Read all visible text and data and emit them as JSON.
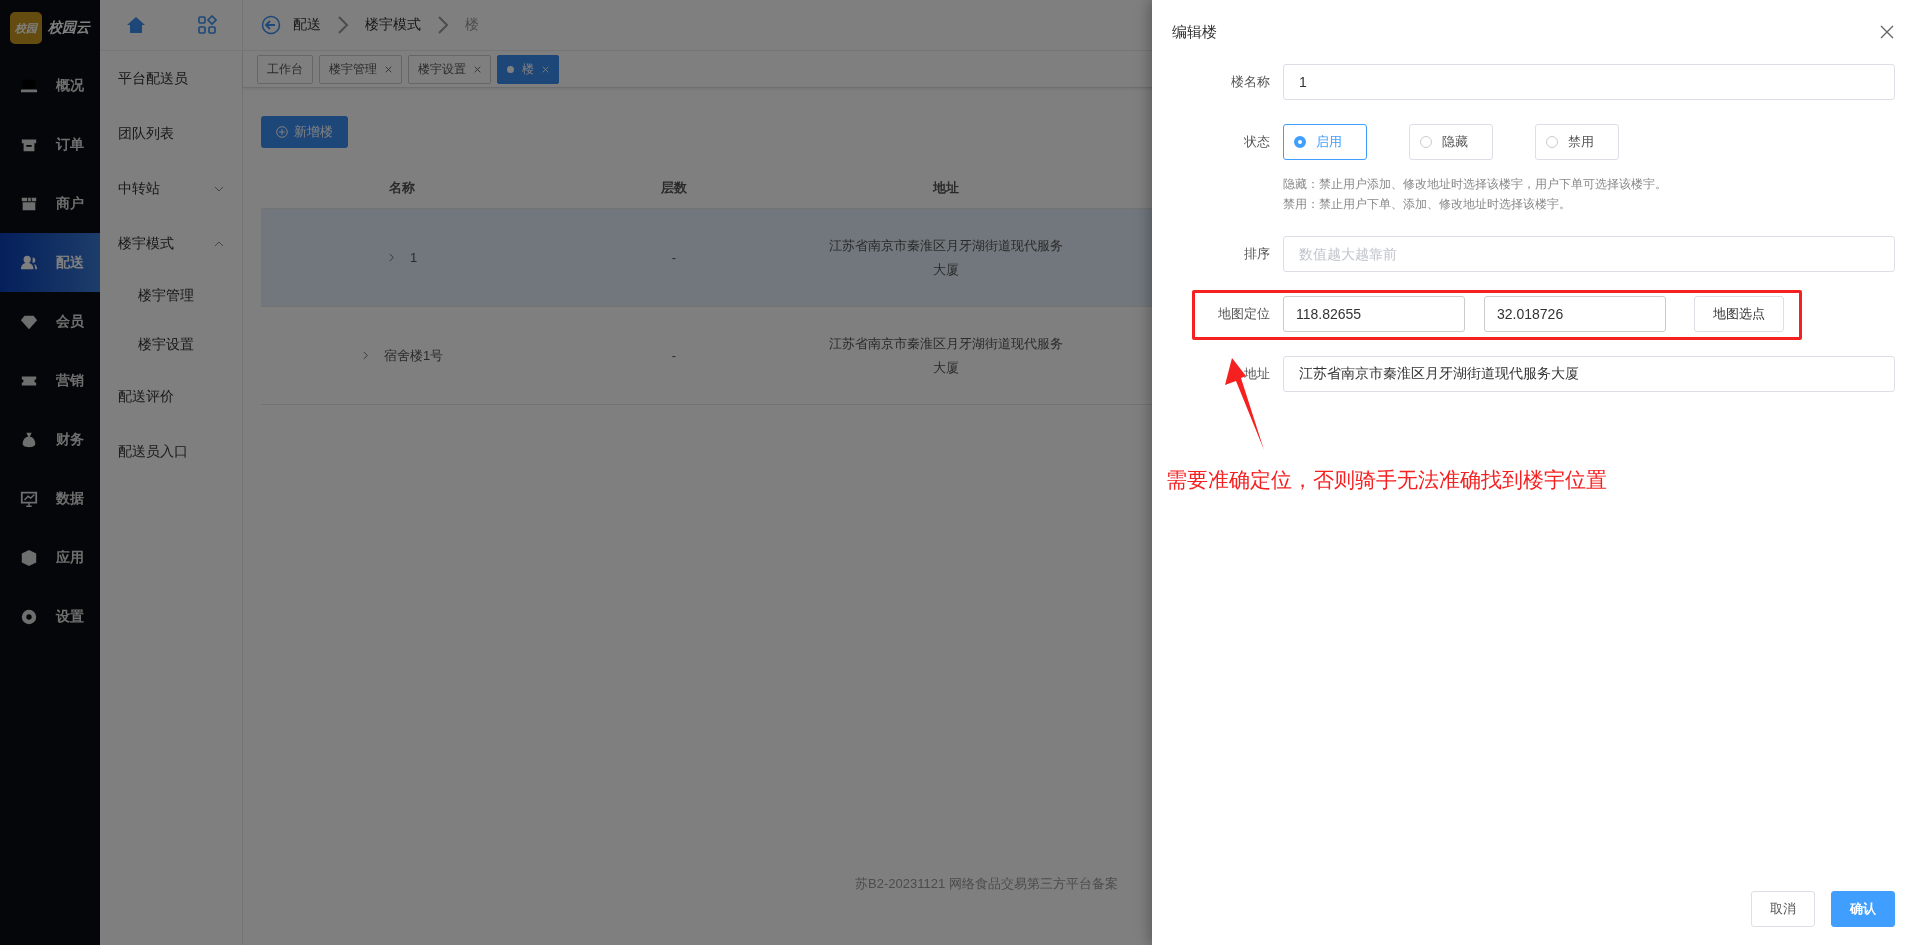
{
  "logo": {
    "badge": "校园",
    "text": "校园云"
  },
  "nav": [
    {
      "label": "概况",
      "selected": false
    },
    {
      "label": "订单",
      "selected": false
    },
    {
      "label": "商户",
      "selected": false
    },
    {
      "label": "配送",
      "selected": true
    },
    {
      "label": "会员",
      "selected": false
    },
    {
      "label": "营销",
      "selected": false
    },
    {
      "label": "财务",
      "selected": false
    },
    {
      "label": "数据",
      "selected": false
    },
    {
      "label": "应用",
      "selected": false
    },
    {
      "label": "设置",
      "selected": false
    }
  ],
  "submenu": [
    {
      "label": "平台配送员"
    },
    {
      "label": "团队列表"
    },
    {
      "label": "中转站",
      "expanded": false
    },
    {
      "label": "楼宇模式",
      "expanded": true,
      "children": [
        {
          "label": "楼宇管理"
        },
        {
          "label": "楼宇设置"
        }
      ]
    },
    {
      "label": "配送评价"
    },
    {
      "label": "配送员入口"
    }
  ],
  "breadcrumb": [
    "配送",
    "楼宇模式",
    "楼"
  ],
  "tabs": [
    {
      "label": "工作台",
      "closable": false,
      "selected": false
    },
    {
      "label": "楼宇管理",
      "closable": true,
      "selected": false
    },
    {
      "label": "楼宇设置",
      "closable": true,
      "selected": false
    },
    {
      "label": "楼",
      "closable": true,
      "selected": true
    }
  ],
  "add_button": "新增楼",
  "table": {
    "columns": [
      "名称",
      "层数",
      "地址"
    ],
    "rows": [
      {
        "name": "1",
        "floors": "-",
        "address": "江苏省南京市秦淮区月牙湖街道现代服务大厦",
        "selected": true
      },
      {
        "name": "宿舍楼1号",
        "floors": "-",
        "address": "江苏省南京市秦淮区月牙湖街道现代服务大厦",
        "selected": false
      }
    ]
  },
  "footer": "苏B2-20231121  网络食品交易第三方平台备案",
  "drawer": {
    "title": "编辑楼",
    "fields": [
      {
        "kind": "input",
        "label": "楼名称",
        "value": "1"
      },
      {
        "kind": "radio",
        "label": "状态",
        "options": [
          {
            "label": "启用",
            "selected": true
          },
          {
            "label": "隐藏",
            "selected": false
          },
          {
            "label": "禁用",
            "selected": false
          }
        ],
        "hints": [
          "隐藏：禁止用户添加、修改地址时选择该楼宇，用户下单可选择该楼宇。",
          "禁用：禁止用户下单、添加、修改地址时选择该楼宇。"
        ]
      },
      {
        "kind": "input",
        "label": "排序",
        "placeholder": "数值越大越靠前"
      },
      {
        "kind": "coords",
        "label": "地图定位",
        "values": [
          "118.82655",
          "32.018726"
        ],
        "button": "地图选点"
      },
      {
        "kind": "input",
        "label": "地址",
        "value": "江苏省南京市秦淮区月牙湖街道现代服务大厦"
      }
    ],
    "annotation": "需要准确定位，否则骑手无法准确找到楼宇位置",
    "buttons": [
      {
        "label": "取消",
        "kind": "default"
      },
      {
        "label": "确认",
        "kind": "primary"
      }
    ]
  }
}
